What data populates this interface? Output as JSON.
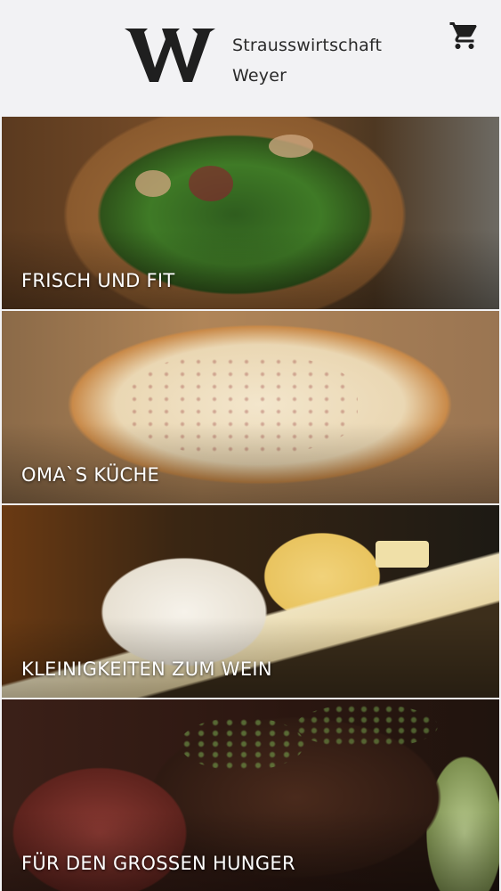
{
  "header": {
    "brand_line1": "Strausswirtschaft",
    "brand_line2": "Weyer",
    "logo_letter": "W",
    "cart_icon": "shopping-cart-icon"
  },
  "categories": [
    {
      "label": "FRISCH UND FIT"
    },
    {
      "label": "OMA`S KÜCHE"
    },
    {
      "label": "KLEINIGKEITEN ZUM WEIN"
    },
    {
      "label": "FÜR DEN GROSSEN HUNGER"
    }
  ],
  "colors": {
    "background": "#f2f2f4",
    "text_dark": "#2a2a2a",
    "label_text": "#ffffff"
  }
}
